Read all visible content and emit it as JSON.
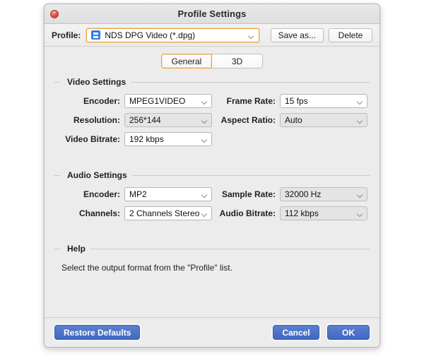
{
  "window": {
    "title": "Profile Settings",
    "close_icon": "close-icon"
  },
  "toolbar": {
    "profile_label": "Profile:",
    "profile_value": "NDS DPG Video (*.dpg)",
    "profile_icon": "profile-document-icon",
    "save_as_label": "Save as...",
    "delete_label": "Delete"
  },
  "tabs": [
    {
      "label": "General",
      "active": true
    },
    {
      "label": "3D",
      "active": false
    }
  ],
  "video_settings": {
    "title": "Video Settings",
    "fields": [
      {
        "label": "Encoder:",
        "value": "MPEG1VIDEO",
        "dim": false
      },
      {
        "label": "Frame Rate:",
        "value": "15 fps",
        "dim": false
      },
      {
        "label": "Resolution:",
        "value": "256*144",
        "dim": true
      },
      {
        "label": "Aspect Ratio:",
        "value": "Auto",
        "dim": true
      },
      {
        "label": "Video Bitrate:",
        "value": "192 kbps",
        "dim": false
      }
    ]
  },
  "audio_settings": {
    "title": "Audio Settings",
    "fields": [
      {
        "label": "Encoder:",
        "value": "MP2",
        "dim": false
      },
      {
        "label": "Sample Rate:",
        "value": "32000 Hz",
        "dim": true
      },
      {
        "label": "Channels:",
        "value": "2 Channels Stereo",
        "dim": false
      },
      {
        "label": "Audio Bitrate:",
        "value": "112 kbps",
        "dim": true
      }
    ]
  },
  "help": {
    "title": "Help",
    "text": "Select the output format from the \"Profile\" list."
  },
  "footer": {
    "restore_defaults_label": "Restore Defaults",
    "cancel_label": "Cancel",
    "ok_label": "OK"
  },
  "colors": {
    "accent_orange": "#e8a33d",
    "button_blue": "#4069c0",
    "close_red": "#e0443e",
    "window_bg": "#ececec"
  }
}
